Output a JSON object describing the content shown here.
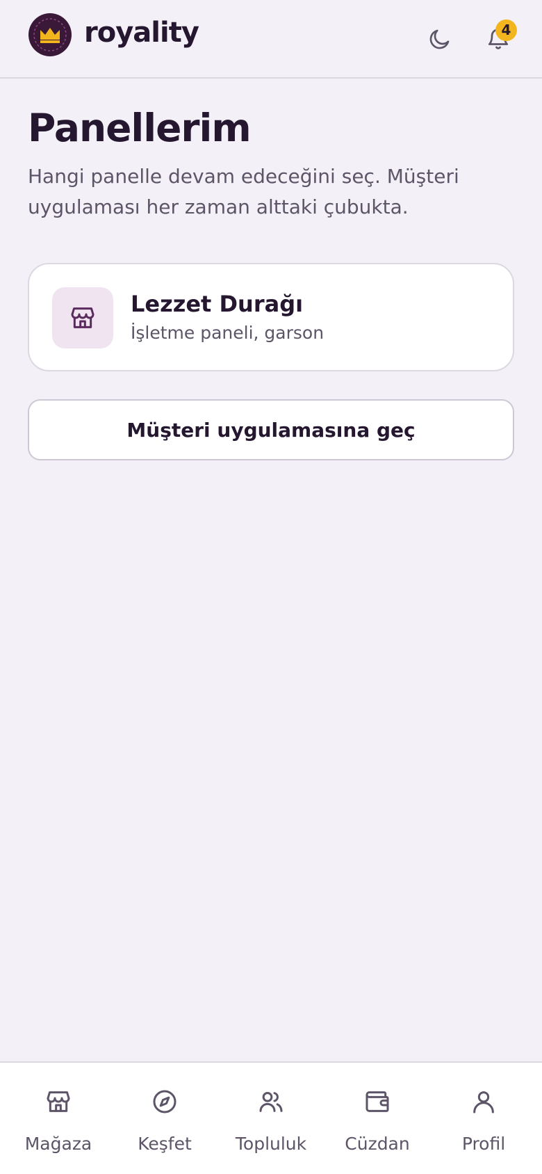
{
  "header": {
    "brand": "royality",
    "logo_icon": "crown-icon",
    "theme_icon": "moon-icon",
    "notification_icon": "bell-icon",
    "notification_count": "4"
  },
  "main": {
    "title": "Panellerim",
    "description": "Hangi panelle devam edeceğini seç. Müşteri uygulaması her zaman alttaki çubukta.",
    "panels": [
      {
        "name": "Lezzet Durağı",
        "subtitle": "İşletme paneli, garson",
        "icon": "store-icon"
      }
    ],
    "switch_button": "Müşteri uygulamasına geç"
  },
  "bottom_nav": {
    "items": [
      {
        "label": "Mağaza",
        "icon": "store-icon"
      },
      {
        "label": "Keşfet",
        "icon": "compass-icon"
      },
      {
        "label": "Topluluk",
        "icon": "users-icon"
      },
      {
        "label": "Cüzdan",
        "icon": "wallet-icon"
      },
      {
        "label": "Profil",
        "icon": "user-icon"
      }
    ]
  },
  "colors": {
    "background": "#f3f1f7",
    "text_primary": "#24172f",
    "text_secondary": "#5e5468",
    "logo_bg": "#3a1838",
    "accent_gold": "#f2b51d",
    "panel_icon_bg": "#efe4f0",
    "panel_icon": "#5a2a5e"
  }
}
